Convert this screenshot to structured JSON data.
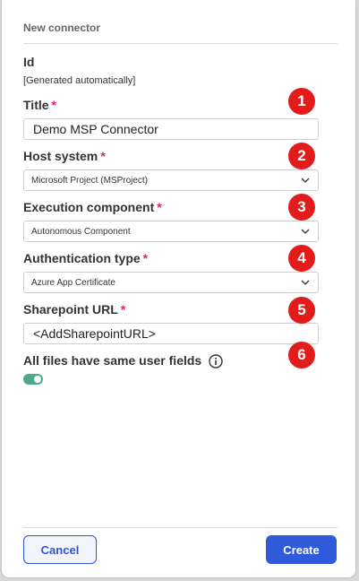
{
  "dialog": {
    "title": "New connector",
    "fields": {
      "id": {
        "label": "Id",
        "value": "[Generated automatically]"
      },
      "title": {
        "label": "Title",
        "required_mark": "*",
        "value": "Demo MSP Connector"
      },
      "host_system": {
        "label": "Host system",
        "required_mark": "*",
        "value": "Microsoft Project (MSProject)"
      },
      "execution_component": {
        "label": "Execution component",
        "required_mark": "*",
        "value": "Autonomous Component"
      },
      "authentication_type": {
        "label": "Authentication type",
        "required_mark": "*",
        "value": "Azure App Certificate"
      },
      "sharepoint_url": {
        "label": "Sharepoint URL",
        "required_mark": "*",
        "value": "<AddSharepointURL>"
      },
      "same_user_fields": {
        "label": "All files have same user fields",
        "enabled": true
      }
    },
    "annotations": [
      "1",
      "2",
      "3",
      "4",
      "5",
      "6"
    ],
    "buttons": {
      "cancel": "Cancel",
      "create": "Create"
    }
  },
  "colors": {
    "accent": "#2f5bdb",
    "required": "#e0245e",
    "annotation": "#e21b1b",
    "toggle_on": "#4ea88a"
  },
  "icons": {
    "dropdown": "chevron-down-icon",
    "info": "info-icon"
  }
}
